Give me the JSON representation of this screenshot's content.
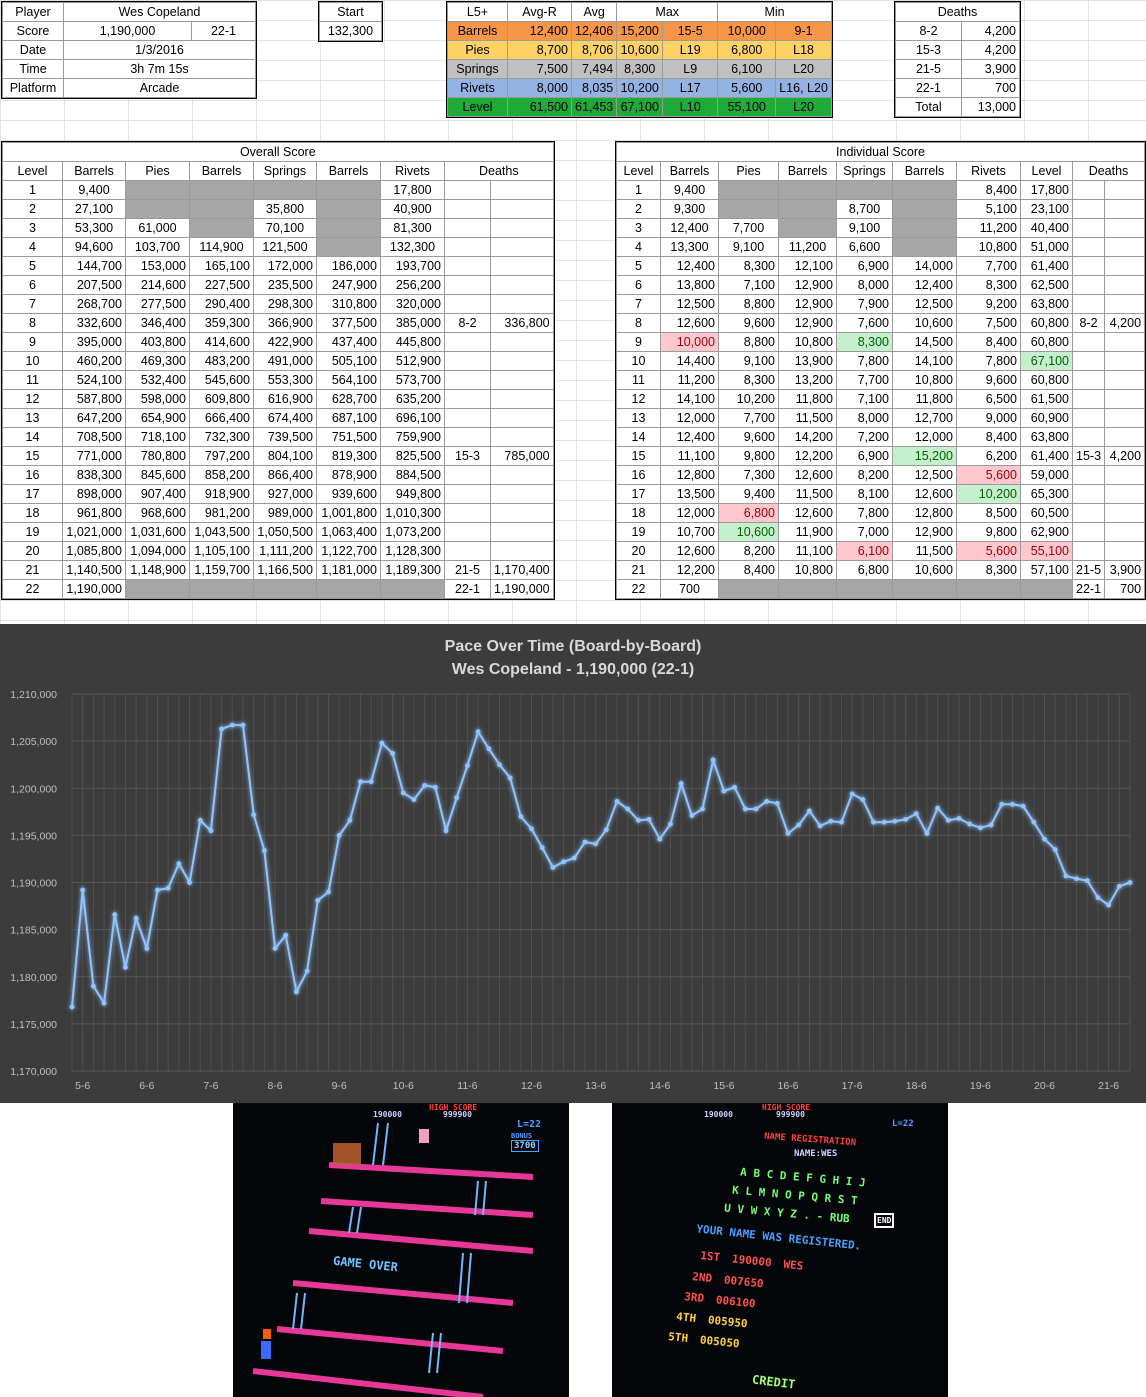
{
  "player": {
    "labels": [
      "Player",
      "Score",
      "Date",
      "Time",
      "Platform"
    ],
    "name": "Wes Copeland",
    "score": "1,190,000",
    "score_level": "22-1",
    "date": "1/3/2016",
    "time": "3h 7m 15s",
    "platform": "Arcade"
  },
  "start": {
    "label": "Start",
    "value": "132,300"
  },
  "stats": {
    "headers": [
      "L5+",
      "Avg-R",
      "Avg",
      "Max",
      "",
      "Min",
      ""
    ],
    "rows": [
      {
        "name": "Barrels",
        "avg_r": "12,400",
        "avg": "12,406",
        "max": "15,200",
        "max_at": "15-5",
        "min": "10,000",
        "min_at": "9-1",
        "color": "#f79646"
      },
      {
        "name": "Pies",
        "avg_r": "8,700",
        "avg": "8,706",
        "max": "10,600",
        "max_at": "L19",
        "min": "6,800",
        "min_at": "L18",
        "color": "#fcd264"
      },
      {
        "name": "Springs",
        "avg_r": "7,500",
        "avg": "7,494",
        "max": "8,300",
        "max_at": "L9",
        "min": "6,100",
        "min_at": "L20",
        "color": "#c0c0c0"
      },
      {
        "name": "Rivets",
        "avg_r": "8,000",
        "avg": "8,035",
        "max": "10,200",
        "max_at": "L17",
        "min": "5,600",
        "min_at": "L16, L20",
        "color": "#95b3e2"
      },
      {
        "name": "Level",
        "avg_r": "61,500",
        "avg": "61,453",
        "max": "67,100",
        "max_at": "L10",
        "min": "55,100",
        "min_at": "L20",
        "color": "#1faa3a"
      }
    ]
  },
  "deaths_summary": {
    "title": "Deaths",
    "rows": [
      [
        "8-2",
        "4,200"
      ],
      [
        "15-3",
        "4,200"
      ],
      [
        "21-5",
        "3,900"
      ],
      [
        "22-1",
        "700"
      ]
    ],
    "total_label": "Total",
    "total": "13,000"
  },
  "overall": {
    "title": "Overall Score",
    "headers": [
      "Level",
      "Barrels",
      "Pies",
      "Barrels",
      "Springs",
      "Barrels",
      "Rivets",
      "Deaths"
    ],
    "rows": [
      [
        "1",
        "9,400",
        "",
        "",
        "",
        "",
        "17,800",
        "",
        ""
      ],
      [
        "2",
        "27,100",
        "",
        "",
        "35,800",
        "",
        "40,900",
        "",
        ""
      ],
      [
        "3",
        "53,300",
        "61,000",
        "",
        "70,100",
        "",
        "81,300",
        "",
        ""
      ],
      [
        "4",
        "94,600",
        "103,700",
        "114,900",
        "121,500",
        "",
        "132,300",
        "",
        ""
      ],
      [
        "5",
        "144,700",
        "153,000",
        "165,100",
        "172,000",
        "186,000",
        "193,700",
        "",
        ""
      ],
      [
        "6",
        "207,500",
        "214,600",
        "227,500",
        "235,500",
        "247,900",
        "256,200",
        "",
        ""
      ],
      [
        "7",
        "268,700",
        "277,500",
        "290,400",
        "298,300",
        "310,800",
        "320,000",
        "",
        ""
      ],
      [
        "8",
        "332,600",
        "346,400",
        "359,300",
        "366,900",
        "377,500",
        "385,000",
        "8-2",
        "336,800"
      ],
      [
        "9",
        "395,000",
        "403,800",
        "414,600",
        "422,900",
        "437,400",
        "445,800",
        "",
        ""
      ],
      [
        "10",
        "460,200",
        "469,300",
        "483,200",
        "491,000",
        "505,100",
        "512,900",
        "",
        ""
      ],
      [
        "11",
        "524,100",
        "532,400",
        "545,600",
        "553,300",
        "564,100",
        "573,700",
        "",
        ""
      ],
      [
        "12",
        "587,800",
        "598,000",
        "609,800",
        "616,900",
        "628,700",
        "635,200",
        "",
        ""
      ],
      [
        "13",
        "647,200",
        "654,900",
        "666,400",
        "674,400",
        "687,100",
        "696,100",
        "",
        ""
      ],
      [
        "14",
        "708,500",
        "718,100",
        "732,300",
        "739,500",
        "751,500",
        "759,900",
        "",
        ""
      ],
      [
        "15",
        "771,000",
        "780,800",
        "797,200",
        "804,100",
        "819,300",
        "825,500",
        "15-3",
        "785,000"
      ],
      [
        "16",
        "838,300",
        "845,600",
        "858,200",
        "866,400",
        "878,900",
        "884,500",
        "",
        ""
      ],
      [
        "17",
        "898,000",
        "907,400",
        "918,900",
        "927,000",
        "939,600",
        "949,800",
        "",
        ""
      ],
      [
        "18",
        "961,800",
        "968,600",
        "981,200",
        "989,000",
        "1,001,800",
        "1,010,300",
        "",
        ""
      ],
      [
        "19",
        "1,021,000",
        "1,031,600",
        "1,043,500",
        "1,050,500",
        "1,063,400",
        "1,073,200",
        "",
        ""
      ],
      [
        "20",
        "1,085,800",
        "1,094,000",
        "1,105,100",
        "1,111,200",
        "1,122,700",
        "1,128,300",
        "",
        ""
      ],
      [
        "21",
        "1,140,500",
        "1,148,900",
        "1,159,700",
        "1,166,500",
        "1,181,000",
        "1,189,300",
        "21-5",
        "1,170,400"
      ],
      [
        "22",
        "1,190,000",
        "",
        "",
        "",
        "",
        "",
        "22-1",
        "1,190,000"
      ]
    ]
  },
  "individual": {
    "title": "Individual Score",
    "headers": [
      "Level",
      "Barrels",
      "Pies",
      "Barrels",
      "Springs",
      "Barrels",
      "Rivets",
      "Level",
      "Deaths"
    ],
    "rows": [
      [
        "1",
        "9,400",
        "",
        "",
        "",
        "",
        "8,400",
        "17,800",
        "",
        ""
      ],
      [
        "2",
        "9,300",
        "",
        "",
        "8,700",
        "",
        "5,100",
        "23,100",
        "",
        ""
      ],
      [
        "3",
        "12,400",
        "7,700",
        "",
        "9,100",
        "",
        "11,200",
        "40,400",
        "",
        ""
      ],
      [
        "4",
        "13,300",
        "9,100",
        "11,200",
        "6,600",
        "",
        "10,800",
        "51,000",
        "",
        ""
      ],
      [
        "5",
        "12,400",
        "8,300",
        "12,100",
        "6,900",
        "14,000",
        "7,700",
        "61,400",
        "",
        ""
      ],
      [
        "6",
        "13,800",
        "7,100",
        "12,900",
        "8,000",
        "12,400",
        "8,300",
        "62,500",
        "",
        ""
      ],
      [
        "7",
        "12,500",
        "8,800",
        "12,900",
        "7,900",
        "12,500",
        "9,200",
        "63,800",
        "",
        ""
      ],
      [
        "8",
        "12,600",
        "9,600",
        "12,900",
        "7,600",
        "10,600",
        "7,500",
        "60,800",
        "8-2",
        "4,200"
      ],
      [
        "9",
        "10,000",
        "8,800",
        "10,800",
        "8,300",
        "14,500",
        "8,400",
        "60,800",
        "",
        ""
      ],
      [
        "10",
        "14,400",
        "9,100",
        "13,900",
        "7,800",
        "14,100",
        "7,800",
        "67,100",
        "",
        ""
      ],
      [
        "11",
        "11,200",
        "8,300",
        "13,200",
        "7,700",
        "10,800",
        "9,600",
        "60,800",
        "",
        ""
      ],
      [
        "12",
        "14,100",
        "10,200",
        "11,800",
        "7,100",
        "11,800",
        "6,500",
        "61,500",
        "",
        ""
      ],
      [
        "13",
        "12,000",
        "7,700",
        "11,500",
        "8,000",
        "12,700",
        "9,000",
        "60,900",
        "",
        ""
      ],
      [
        "14",
        "12,400",
        "9,600",
        "14,200",
        "7,200",
        "12,000",
        "8,400",
        "63,800",
        "",
        ""
      ],
      [
        "15",
        "11,100",
        "9,800",
        "12,200",
        "6,900",
        "15,200",
        "6,200",
        "61,400",
        "15-3",
        "4,200"
      ],
      [
        "16",
        "12,800",
        "7,300",
        "12,600",
        "8,200",
        "12,500",
        "5,600",
        "59,000",
        "",
        ""
      ],
      [
        "17",
        "13,500",
        "9,400",
        "11,500",
        "8,100",
        "12,600",
        "10,200",
        "65,300",
        "",
        ""
      ],
      [
        "18",
        "12,000",
        "6,800",
        "12,600",
        "7,800",
        "12,800",
        "8,500",
        "60,500",
        "",
        ""
      ],
      [
        "19",
        "10,700",
        "10,600",
        "11,900",
        "7,000",
        "12,900",
        "9,800",
        "62,900",
        "",
        ""
      ],
      [
        "20",
        "12,600",
        "8,200",
        "11,100",
        "6,100",
        "11,500",
        "5,600",
        "55,100",
        "",
        ""
      ],
      [
        "21",
        "12,200",
        "8,400",
        "10,800",
        "6,800",
        "10,600",
        "8,300",
        "57,100",
        "21-5",
        "3,900"
      ],
      [
        "22",
        "700",
        "",
        "",
        "",
        "",
        "",
        "",
        "22-1",
        "700"
      ]
    ]
  },
  "chart_data": {
    "type": "line",
    "title": "Pace Over Time (Board-by-Board)",
    "subtitle": "Wes Copeland - 1,190,000 (22-1)",
    "xlabel": "",
    "ylabel": "",
    "ylim": [
      1170000,
      1210000
    ],
    "yticks": [
      "1,170,000",
      "1,175,000",
      "1,180,000",
      "1,185,000",
      "1,190,000",
      "1,195,000",
      "1,200,000",
      "1,205,000",
      "1,210,000"
    ],
    "xticks": [
      "5-6",
      "6-6",
      "7-6",
      "8-6",
      "9-6",
      "10-6",
      "11-6",
      "12-6",
      "13-6",
      "14-6",
      "15-6",
      "16-6",
      "17-6",
      "18-6",
      "19-6",
      "20-6",
      "21-6"
    ],
    "grid": true,
    "color": "#8fc4ff",
    "values": [
      1176800,
      1189200,
      1179000,
      1177200,
      1186600,
      1181000,
      1186200,
      1183000,
      1189200,
      1189400,
      1192000,
      1190000,
      1196600,
      1195500,
      1206300,
      1206700,
      1206700,
      1197200,
      1193400,
      1183000,
      1184400,
      1178400,
      1180600,
      1188100,
      1189000,
      1195000,
      1196600,
      1200700,
      1200700,
      1204800,
      1203700,
      1199500,
      1198800,
      1200300,
      1200100,
      1195500,
      1199000,
      1202400,
      1206000,
      1204200,
      1202500,
      1201100,
      1197000,
      1195700,
      1193700,
      1191600,
      1192200,
      1192600,
      1194300,
      1194100,
      1195600,
      1198600,
      1197800,
      1196600,
      1196700,
      1194600,
      1196200,
      1200500,
      1197100,
      1197800,
      1203000,
      1199700,
      1200100,
      1197800,
      1197800,
      1198600,
      1198400,
      1195200,
      1196100,
      1197600,
      1196000,
      1196500,
      1196400,
      1199400,
      1198800,
      1196400,
      1196400,
      1196500,
      1196700,
      1197300,
      1195200,
      1197900,
      1196600,
      1196800,
      1196200,
      1195800,
      1196100,
      1198300,
      1198300,
      1198100,
      1196400,
      1194600,
      1193500,
      1190700,
      1190400,
      1190200,
      1188400,
      1187600,
      1189600,
      1190000
    ]
  },
  "photo_left": {
    "score": "190000",
    "high_score_label": "HIGH SCORE",
    "high_score": "999900",
    "level": "L=22",
    "bonus_label": "BONUS",
    "bonus": "3700",
    "game_over": "GAME OVER"
  },
  "photo_right": {
    "score": "190000",
    "high_score_label": "HIGH SCORE",
    "high_score": "999900",
    "level": "L=22",
    "name_registration": "NAME REGISTRATION",
    "name_line": "NAME:WES",
    "letters_1": "A B C D E F G H I J",
    "letters_2": "K L M N O P Q R S T",
    "letters_3": "U V W X Y Z . - RUB",
    "end_key": "END",
    "registered": "YOUR NAME WAS REGISTERED.",
    "rank_labels": [
      "1ST",
      "2ND",
      "3RD",
      "4TH",
      "5TH"
    ],
    "rank_scores": [
      "190000",
      "007650",
      "006100",
      "005950",
      "005050"
    ],
    "rank_names": [
      "WES",
      "",
      "",
      "",
      ""
    ],
    "credit": "CREDIT"
  }
}
